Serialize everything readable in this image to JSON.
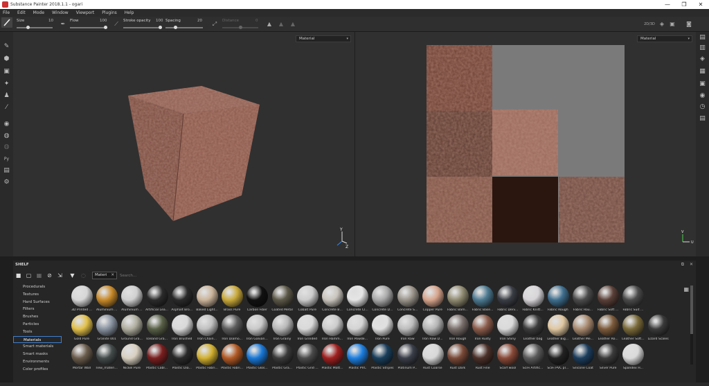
{
  "window": {
    "title": "Substance Painter 2018.1.1 - ogari",
    "minimize": "—",
    "maximize": "❐",
    "close": "✕"
  },
  "menu": [
    "File",
    "Edit",
    "Mode",
    "Window",
    "Viewport",
    "Plugins",
    "Help"
  ],
  "tool_options": {
    "size": {
      "label": "Size",
      "value": "10",
      "level": 0.3
    },
    "flow": {
      "label": "Flow",
      "value": "100",
      "level": 1.0
    },
    "stroke_opacity": {
      "label": "Stroke opacity",
      "value": "100",
      "level": 1.0
    },
    "spacing": {
      "label": "Spacing",
      "value": "20",
      "level": 0.25
    },
    "distance": {
      "label": "Distance",
      "value": "0",
      "level": 0.5
    },
    "view_toggle": "2D/3D"
  },
  "viewport_3d": {
    "channel": "Material"
  },
  "viewport_2d": {
    "channel": "Material"
  },
  "shelf": {
    "title": "SHELF",
    "filter_tag": "Materi",
    "search_placeholder": "Search...",
    "categories": [
      "Procedurals",
      "Textures",
      "Hard Surfaces",
      "Filters",
      "Brushes",
      "Particles",
      "Tools",
      "Materials",
      "Smart materials",
      "Smart masks",
      "Environments",
      "Color profiles"
    ],
    "active_category": "Materials",
    "materials": [
      [
        "3D Printed ...",
        "Aluminium ...",
        "Aluminium ...",
        "Artificial Lea...",
        "Asphalt Bro...",
        "Baked Light...",
        "Brass Pure",
        "Carbon Fiber",
        "Coated Metal",
        "Cobalt Pure",
        "Concrete B...",
        "Concrete Cl...",
        "Concrete D...",
        "Concrete S...",
        "Copper Pure",
        "Fabric Bam...",
        "Fabric Base...",
        "Fabric Deni...",
        "Fabric Knitt...",
        "Fabric Rough",
        "Fabric Rou...",
        "Fabric Soft ...",
        "Fabric Suit ..."
      ],
      [
        "Gold Pure",
        "Granite 001",
        "Ground Gra...",
        "Iceland Gra...",
        "Iron Brushed",
        "Iron Chain...",
        "Iron Diamo...",
        "Iron Galvan...",
        "Iron Grainy",
        "Iron Grinded",
        "Iron Hamm...",
        "Iron Powde...",
        "Iron Pure",
        "Iron Raw",
        "Iron Raw D...",
        "Iron Rough",
        "Iron Rusty",
        "Iron Shiny",
        "Leather bag",
        "Leather Big...",
        "Leather Me...",
        "Leather Ro...",
        "Leather Soft...",
        "Lizard Scales"
      ],
      [
        "Mortar Wall",
        "new_materi...",
        "Nickel Pure",
        "Plastic Cabl...",
        "Plastic Dia...",
        "Plastic Fabri...",
        "Plastic Fabri...",
        "Plastic Glos...",
        "Plastic Gra...",
        "Plastic Grid ...",
        "Plastic Matt...",
        "Plastic PVC",
        "Plastic Stripes",
        "Platinum P...",
        "Rust Coarse",
        "Rust Dark",
        "Rust Fine",
        "Scarf wool",
        "SciFi Artific...",
        "SciFi PVC pl...",
        "Silicone Coat",
        "Silver Pure",
        "Spandex H..."
      ]
    ],
    "colors": [
      [
        "#d7d7d7",
        "#c88a2a",
        "#d0d0d0",
        "#2b2b2b",
        "#2a2a2a",
        "#cbb49a",
        "#c9a93a",
        "#111111",
        "#5c5848",
        "#cccccc",
        "#c9c4bd",
        "#e5e5e5",
        "#a9a9a9",
        "#9a948b",
        "#d7a48c",
        "#8f8a70",
        "#4c7990",
        "#3a3d45",
        "#d8d5d9",
        "#3f6e8e",
        "#4b4b4b",
        "#5a4038",
        "#4a4a4a"
      ],
      [
        "#e2c04a",
        "#8892a0",
        "#b0ae9f",
        "#596047",
        "#d9d9d9",
        "#c0c0c0",
        "#5c5c5c",
        "#c9c9c9",
        "#b8b8b8",
        "#d9d9d9",
        "#cccccc",
        "#d4d4d4",
        "#e0e0e0",
        "#bdbdbd",
        "#b4b4b4",
        "#7a6f6b",
        "#8b5c4b",
        "#dadada",
        "#3c3c3c",
        "#e0c7a0",
        "#a98b70",
        "#7d5b3c",
        "#7a6a3a",
        "#3a3a3a"
      ],
      [
        "#6a5c4c",
        "#444a4a",
        "#d8d0c0",
        "#7a1f1f",
        "#2a2a2a",
        "#d2b030",
        "#b25a25",
        "#1a78d6",
        "#3a3a3a",
        "#4a4a4a",
        "#a02020",
        "#1e7fe0",
        "#1a3e5a",
        "#3a3e48",
        "#d8d8d8",
        "#7a4a38",
        "#4a3028",
        "#8a4a38",
        "#5a5a5a",
        "#222222",
        "#1c3d5c",
        "#3a3a3a",
        "#dadada",
        "#1e3fa0"
      ]
    ]
  }
}
